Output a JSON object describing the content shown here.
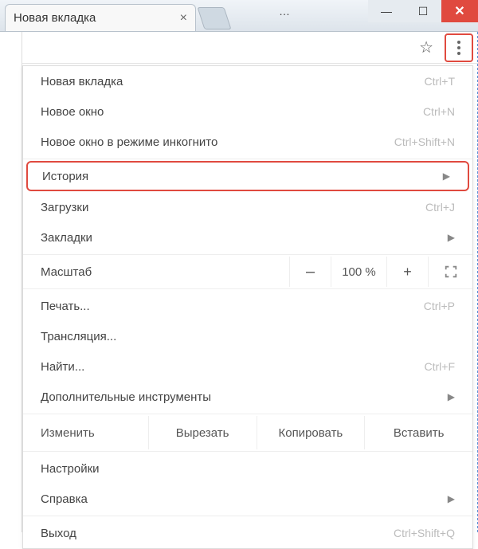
{
  "titlebar": {
    "tab_label": "Новая вкладка",
    "truncated_title": "…"
  },
  "menu": {
    "new_tab": {
      "label": "Новая вкладка",
      "shortcut": "Ctrl+T"
    },
    "new_window": {
      "label": "Новое окно",
      "shortcut": "Ctrl+N"
    },
    "incognito": {
      "label": "Новое окно в режиме инкогнито",
      "shortcut": "Ctrl+Shift+N"
    },
    "history": {
      "label": "История"
    },
    "downloads": {
      "label": "Загрузки",
      "shortcut": "Ctrl+J"
    },
    "bookmarks": {
      "label": "Закладки"
    },
    "zoom": {
      "label": "Масштаб",
      "minus": "–",
      "value": "100 %",
      "plus": "+"
    },
    "print": {
      "label": "Печать...",
      "shortcut": "Ctrl+P"
    },
    "cast": {
      "label": "Трансляция..."
    },
    "find": {
      "label": "Найти...",
      "shortcut": "Ctrl+F"
    },
    "more_tools": {
      "label": "Дополнительные инструменты"
    },
    "edit": {
      "label": "Изменить",
      "cut": "Вырезать",
      "copy": "Копировать",
      "paste": "Вставить"
    },
    "settings": {
      "label": "Настройки"
    },
    "help": {
      "label": "Справка"
    },
    "exit": {
      "label": "Выход",
      "shortcut": "Ctrl+Shift+Q"
    }
  },
  "glyphs": {
    "submenu_arrow": "▶",
    "star": "☆",
    "tab_close": "×",
    "win_min": "—",
    "win_max": "☐",
    "win_close": "✕"
  }
}
